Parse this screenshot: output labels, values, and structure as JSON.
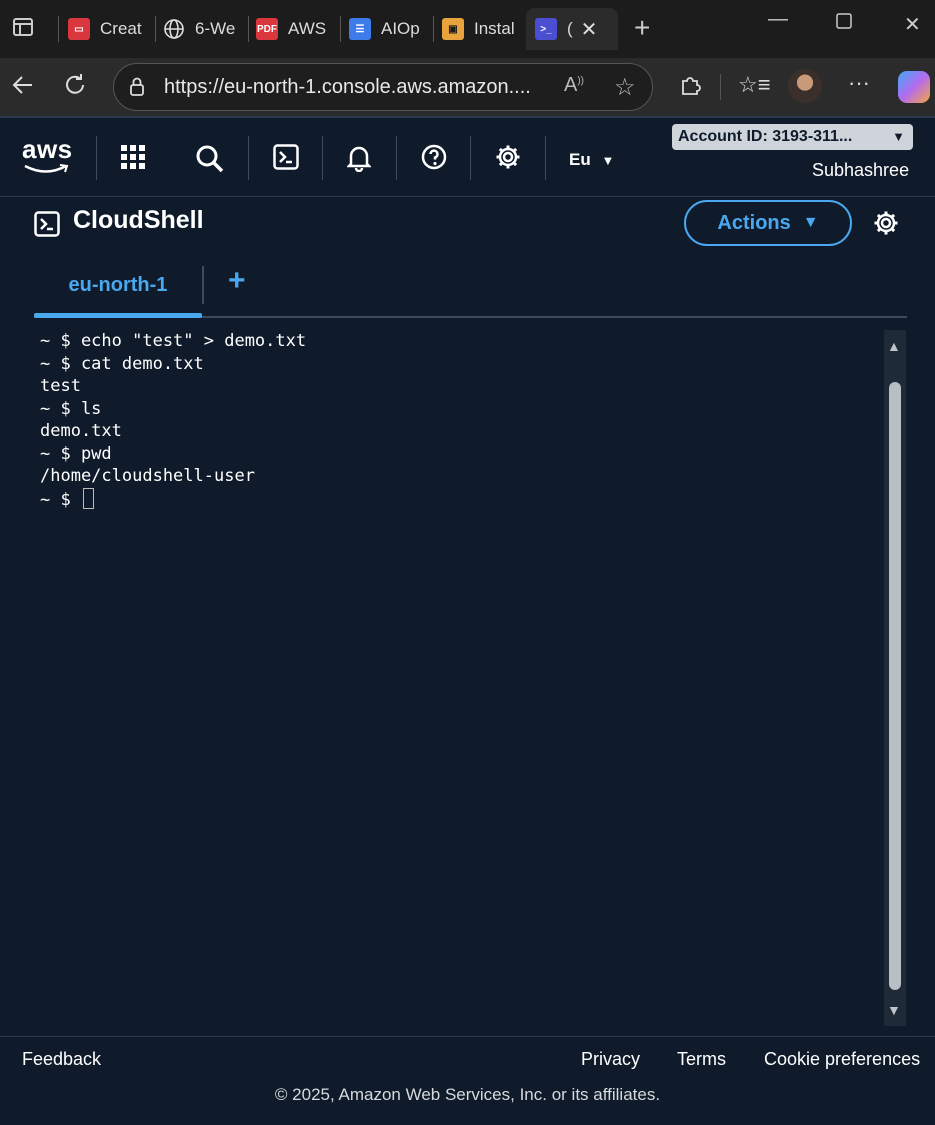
{
  "browser": {
    "tabs": [
      {
        "label": "Creat",
        "icon": "form-icon",
        "color": "#d9363e"
      },
      {
        "label": "6-We",
        "icon": "globe-icon",
        "color": "#1c1c1c"
      },
      {
        "label": "AWS",
        "icon": "pdf-icon",
        "color": "#d9363e"
      },
      {
        "label": "AIOp",
        "icon": "doc-icon",
        "color": "#3d7be8"
      },
      {
        "label": "Instal",
        "icon": "package-icon",
        "color": "#e8a33d"
      },
      {
        "label": "(",
        "icon": "cloudshell-icon",
        "color": "#4a4fd1"
      }
    ],
    "url": "https://eu-north-1.console.aws.amazon...."
  },
  "aws_nav": {
    "logo": "aws",
    "region": "Eu",
    "account": "Account ID: 3193-311...",
    "user": "Subhashree"
  },
  "cloudshell": {
    "title": "CloudShell",
    "actions_label": "Actions",
    "active_tab": "eu-north-1",
    "add_tab": "+"
  },
  "terminal": {
    "lines": [
      "~ $ echo \"test\" > demo.txt",
      "~ $ cat demo.txt",
      "test",
      "~ $ ls",
      "demo.txt",
      "~ $ pwd",
      "/home/cloudshell-user"
    ],
    "prompt": "~ $ "
  },
  "footer": {
    "feedback": "Feedback",
    "privacy": "Privacy",
    "terms": "Terms",
    "cookies": "Cookie preferences",
    "copyright": "© 2025, Amazon Web Services, Inc. or its affiliates."
  },
  "colors": {
    "accent": "#4aa8f0",
    "background": "#0f1b2a"
  }
}
